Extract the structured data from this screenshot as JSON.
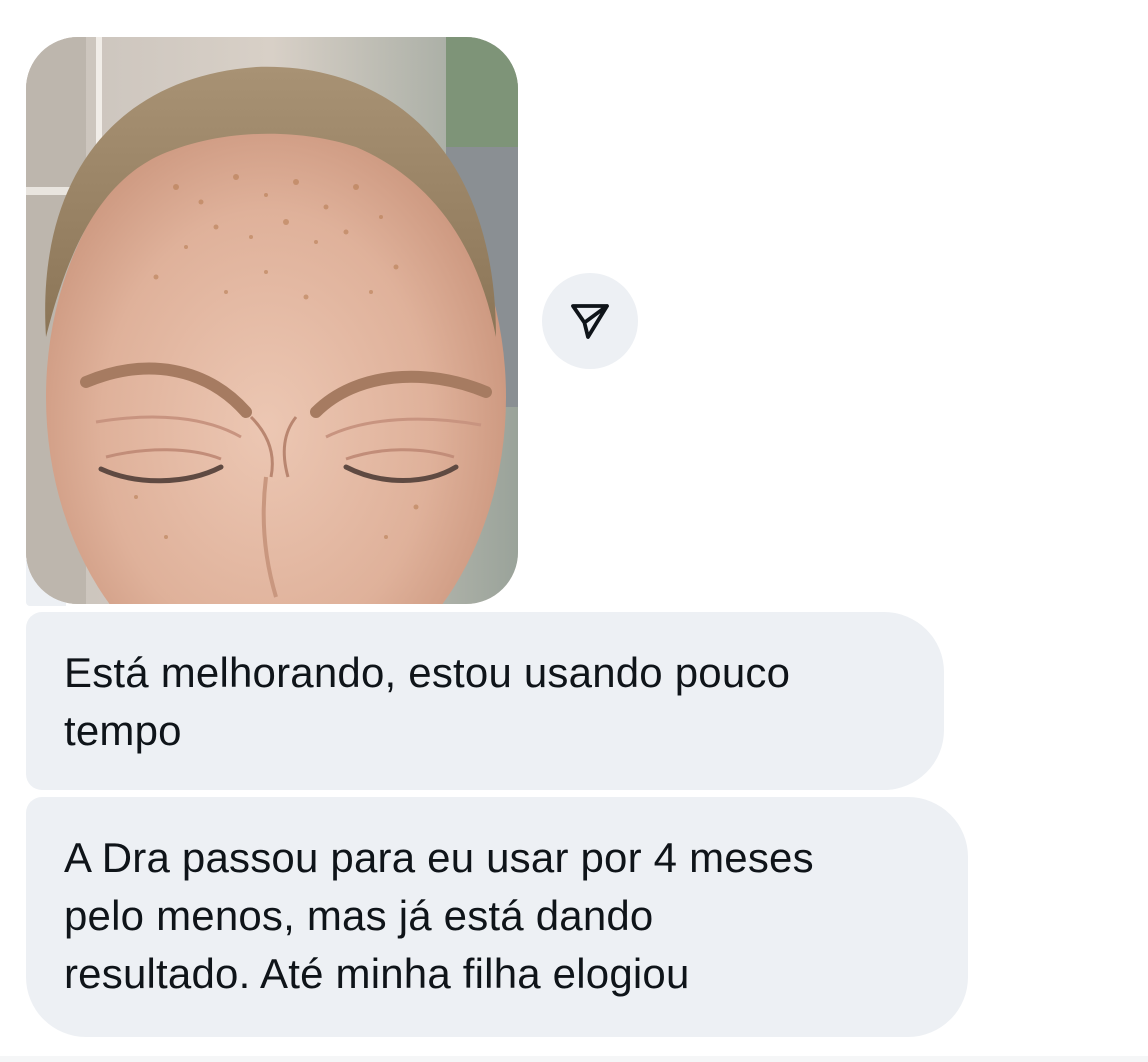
{
  "conversation": {
    "photo_message": {
      "icon": "photo-attachment"
    },
    "share_button": {
      "icon": "send-share-icon"
    },
    "messages": [
      {
        "lines": [
          "Está melhorando, estou usando pouco",
          "tempo"
        ]
      },
      {
        "lines": [
          "A Dra passou para eu usar por 4 meses",
          "pelo menos, mas já está dando",
          "resultado. Até minha filha elogiou"
        ]
      }
    ]
  },
  "colors": {
    "bubble_background": "#edf0f4",
    "text": "#0f1419",
    "background": "#ffffff"
  }
}
